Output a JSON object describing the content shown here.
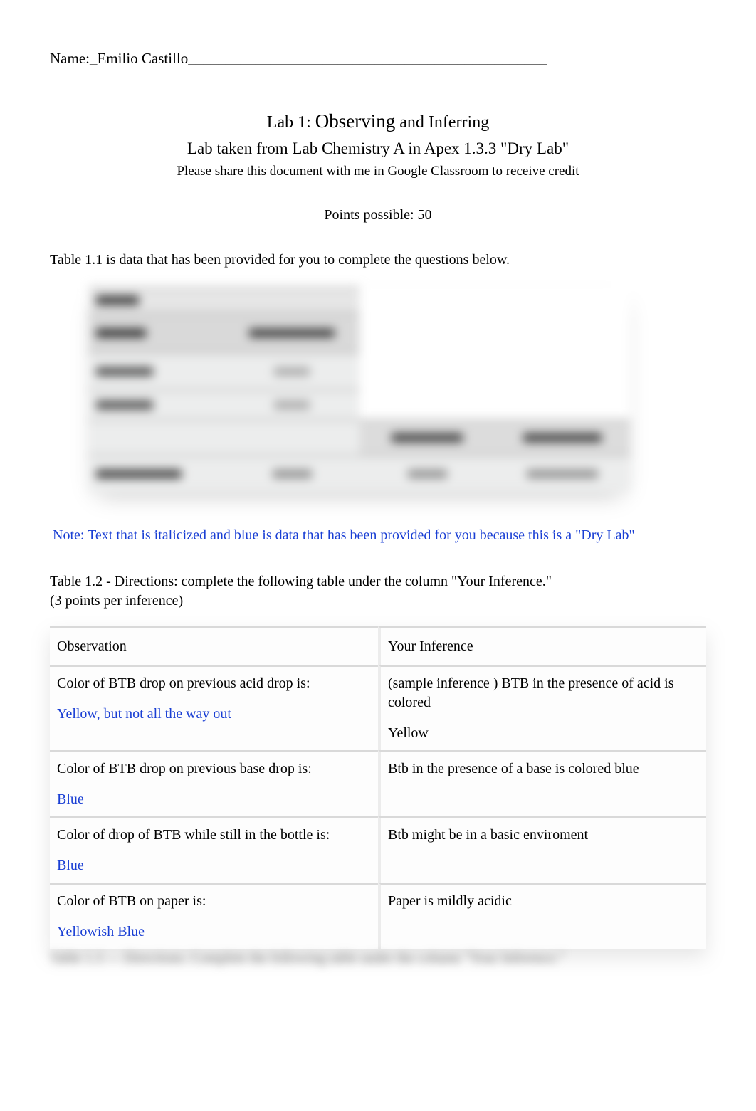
{
  "name_label": "Name:",
  "name_value": "_Emilio Castillo________________________________________________",
  "lab_number_prefix": "Lab 1:  ",
  "lab_observing": "Observing",
  "lab_and_inferring": "   and Inferring",
  "lab_subtitle": "Lab taken from Lab Chemistry A in Apex 1.3.3 \"Dry Lab\"",
  "share_note": "Please share this document with me in Google Classroom to receive credit",
  "points": "Points possible: 50",
  "intro": "Table 1.1 is data that has been provided for you to complete the questions below.",
  "note_blue": "Note: Text that is italicized and blue is data that has been provided for you because this is a \"Dry Lab\"",
  "directions_line1": "Table 1.2 - Directions: complete the following table under the column \"Your Inference.\"",
  "directions_line2": "(3 points per inference)",
  "table": {
    "header_observation": "Observation",
    "header_inference": "Your Inference",
    "rows": [
      {
        "obs_prompt": "Color of BTB drop on previous acid drop is:",
        "obs_provided": "Yellow, but not all the way out",
        "inf_line1": "(sample inference ) BTB in the presence of acid is colored",
        "inf_line2": "Yellow"
      },
      {
        "obs_prompt": "Color of BTB drop on previous base drop is:",
        "obs_provided": "Blue",
        "inf_line1": "Btb in the presence of a base is colored blue",
        "inf_line2": ""
      },
      {
        "obs_prompt": "Color of drop of BTB while still in the bottle is:",
        "obs_provided": "Blue",
        "inf_line1": "Btb might be in a basic enviroment",
        "inf_line2": ""
      },
      {
        "obs_prompt": "Color of BTB on paper is:",
        "obs_provided": "Yellowish Blue",
        "inf_line1": "Paper is mildly acidic",
        "inf_line2": ""
      }
    ]
  },
  "blurred_footer": "Table 1.3 — Directions: Complete the following table under the column \"Your Inference.\""
}
